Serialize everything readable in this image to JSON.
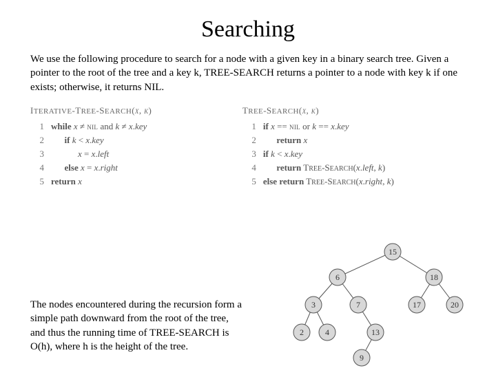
{
  "title": "Searching",
  "intro": "We use the following procedure to search for a node with a given key in a binary search tree. Given a pointer to the root of the tree and a key k, TREE-SEARCH returns a pointer to a node with key k if one exists; otherwise, it returns NIL.",
  "iter": {
    "head": "Iterative-Tree-Search(x, k)",
    "l1": "while x ≠ NIL and k ≠ x.key",
    "l2": "      if k < x.key",
    "l3": "            x = x.left",
    "l4": "      else x = x.right",
    "l5": "return x"
  },
  "rec": {
    "head": "Tree-Search(x, k)",
    "l1": "if x == NIL or k == x.key",
    "l2": "      return x",
    "l3": "if k < x.key",
    "l4": "      return Tree-Search(x.left, k)",
    "l5": "else return Tree-Search(x.right, k)"
  },
  "note": "The nodes encountered during the recursion form a simple path downward from the root of the tree, and thus the running time of TREE-SEARCH is O(h), where h is the height of the tree.",
  "tree": {
    "nodes": [
      15,
      6,
      18,
      3,
      7,
      17,
      20,
      2,
      4,
      13,
      9
    ],
    "edges": [
      [
        15,
        6
      ],
      [
        15,
        18
      ],
      [
        6,
        3
      ],
      [
        6,
        7
      ],
      [
        18,
        17
      ],
      [
        18,
        20
      ],
      [
        3,
        2
      ],
      [
        3,
        4
      ],
      [
        7,
        13
      ],
      [
        13,
        9
      ]
    ]
  }
}
